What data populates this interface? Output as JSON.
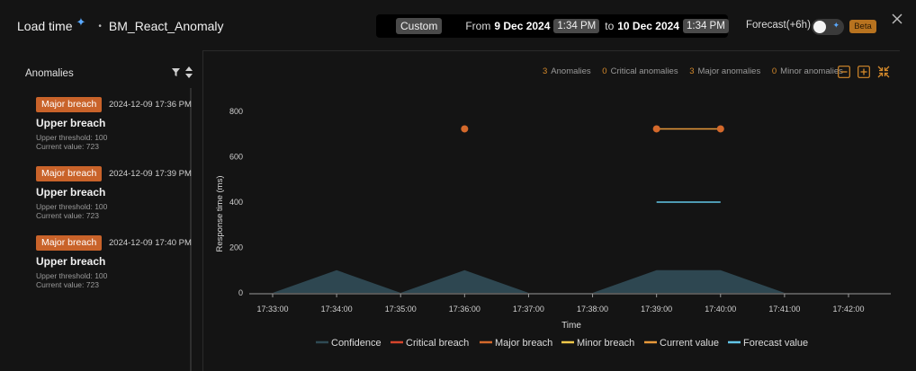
{
  "header": {
    "title": "Load time",
    "app_name": "BM_React_Anomaly"
  },
  "timerange": {
    "preset": "Custom",
    "from_label": "From",
    "from_date": "9 Dec 2024",
    "from_time": "1:34 PM",
    "to_label": "to",
    "to_date": "10 Dec 2024",
    "to_time": "1:34 PM"
  },
  "forecast": {
    "label": "Forecast(+6h)",
    "enabled": false,
    "beta_label": "Beta"
  },
  "sidebar": {
    "title": "Anomalies",
    "items": [
      {
        "badge": "Major breach",
        "timestamp": "2024-12-09 17:36 PM",
        "title": "Upper breach",
        "threshold": "Upper threshold: 100",
        "current": "Current value: 723"
      },
      {
        "badge": "Major breach",
        "timestamp": "2024-12-09 17:39 PM",
        "title": "Upper breach",
        "threshold": "Upper threshold: 100",
        "current": "Current value: 723"
      },
      {
        "badge": "Major breach",
        "timestamp": "2024-12-09 17:40 PM",
        "title": "Upper breach",
        "threshold": "Upper threshold: 100",
        "current": "Current value: 723"
      }
    ]
  },
  "summary": {
    "anomalies": {
      "count": "3",
      "label": "Anomalies"
    },
    "critical": {
      "count": "0",
      "label": "Critical anomalies"
    },
    "major": {
      "count": "3",
      "label": "Major anomalies"
    },
    "minor": {
      "count": "0",
      "label": "Minor anomalies"
    }
  },
  "colors": {
    "accent": "#c9632a",
    "major": "#d4692b",
    "critical": "#d6452c",
    "minor": "#f0c84a",
    "current": "#e8993a",
    "forecast": "#62c6e8",
    "confidence": "#2f4a54"
  },
  "icons": [
    "calendar-icon",
    "sparkle-icon",
    "close-icon",
    "filter-icon",
    "sort-icon",
    "zoom-out-icon",
    "zoom-in-icon",
    "collapse-icon"
  ],
  "chart_data": {
    "type": "line",
    "xlabel": "Time",
    "ylabel": "Response time (ms)",
    "x": [
      "17:33:00",
      "17:34:00",
      "17:35:00",
      "17:36:00",
      "17:37:00",
      "17:38:00",
      "17:39:00",
      "17:40:00",
      "17:41:00",
      "17:42:00"
    ],
    "ylim": [
      0,
      800
    ],
    "yticks": [
      0,
      200,
      400,
      600,
      800
    ],
    "legend_position": "bottom",
    "series": [
      {
        "name": "Confidence",
        "type": "area",
        "color": "#2f4a54",
        "points": [
          [
            "17:33:00",
            0
          ],
          [
            "17:34:00",
            100
          ],
          [
            "17:35:00",
            0
          ],
          [
            "17:36:00",
            100
          ],
          [
            "17:37:00",
            0
          ],
          [
            "17:38:00",
            0
          ],
          [
            "17:39:00",
            100
          ],
          [
            "17:40:00",
            100
          ],
          [
            "17:41:00",
            0
          ]
        ]
      },
      {
        "name": "Critical breach",
        "type": "scatter",
        "color": "#d6452c",
        "points": []
      },
      {
        "name": "Major breach",
        "type": "scatter",
        "color": "#d4692b",
        "points": [
          [
            "17:36:00",
            723
          ],
          [
            "17:39:00",
            723
          ],
          [
            "17:40:00",
            723
          ]
        ]
      },
      {
        "name": "Minor breach",
        "type": "scatter",
        "color": "#f0c84a",
        "points": []
      },
      {
        "name": "Current value",
        "type": "line",
        "color": "#e8993a",
        "points": [
          [
            "17:39:00",
            723
          ],
          [
            "17:40:00",
            723
          ]
        ]
      },
      {
        "name": "Forecast value",
        "type": "line",
        "color": "#62c6e8",
        "points": [
          [
            "17:39:00",
            400
          ],
          [
            "17:40:00",
            400
          ]
        ]
      }
    ]
  }
}
